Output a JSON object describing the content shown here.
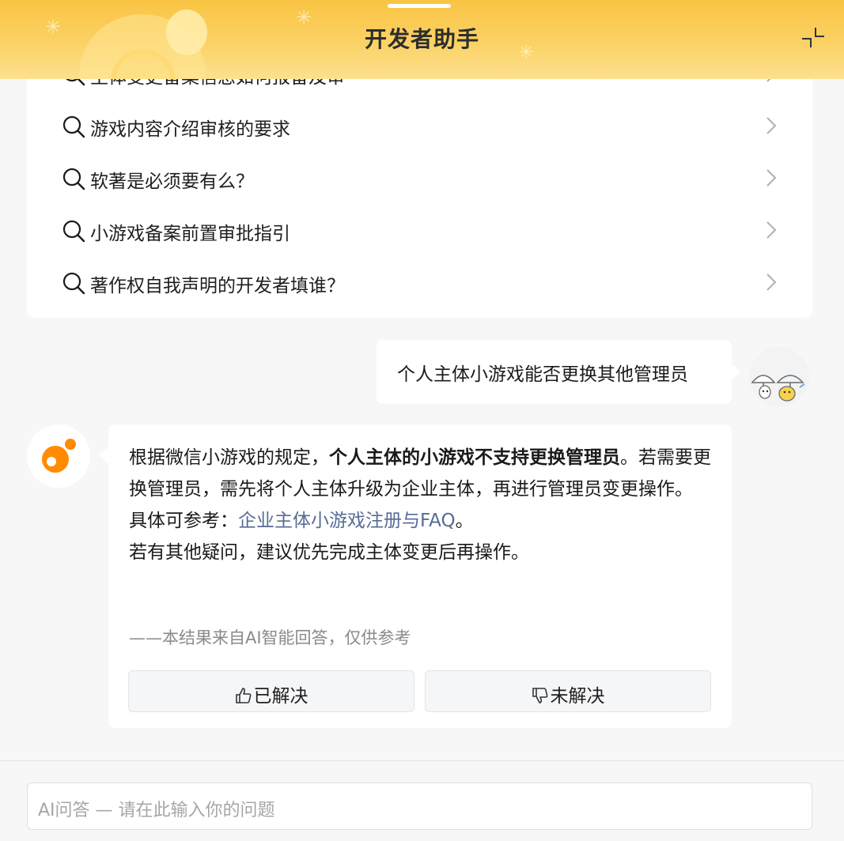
{
  "header": {
    "title": "开发者助手",
    "minimize_icon": "minimize-icon"
  },
  "faq": {
    "items": [
      {
        "label": "主体变更备案信息如何报备及审",
        "icon": "search-icon"
      },
      {
        "label": "游戏内容介绍审核的要求",
        "icon": "search-icon"
      },
      {
        "label": "软著是必须要有么？",
        "icon": "search-icon"
      },
      {
        "label": "小游戏备案前置审批指引",
        "icon": "search-icon"
      },
      {
        "label": "著作权自我声明的开发者填谁？",
        "icon": "search-icon"
      }
    ]
  },
  "user_message": {
    "text": "个人主体小游戏能否更换其他管理员"
  },
  "bot_message": {
    "part1": "根据微信小游戏的规定，",
    "bold": "个人主体的小游戏不支持更换管理员",
    "part2": "。若需要更换管理员，需先将个人主体升级为企业主体，再进行管理员变更操作。",
    "ref_prefix": "具体可参考：",
    "ref_link": "企业主体小游戏注册与FAQ",
    "ref_suffix": "。",
    "closing": "若有其他疑问，建议优先完成主体变更后再操作。",
    "disclaimer": "——本结果来自AI智能回答，仅供参考"
  },
  "feedback": {
    "solved": "已解决",
    "unsolved": "未解决"
  },
  "input": {
    "placeholder": "AI问答 — 请在此输入你的问题"
  },
  "colors": {
    "header_top": "#f9c443",
    "header_bottom": "#fde08f",
    "bot_orange": "#ff8c00",
    "link": "#576b95",
    "background": "#f7f7f7"
  }
}
